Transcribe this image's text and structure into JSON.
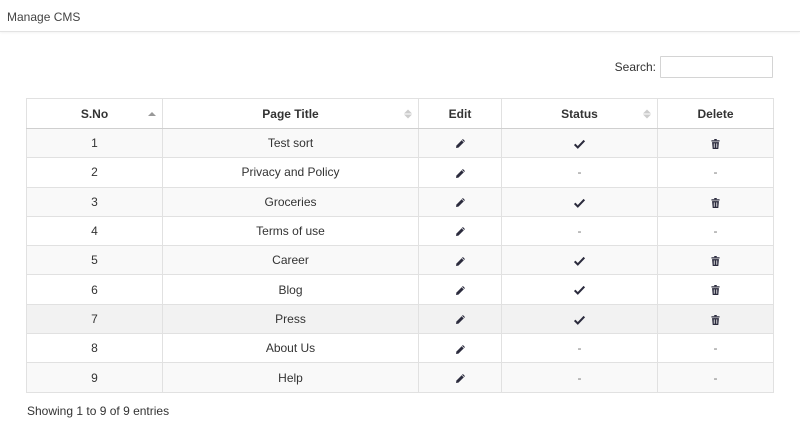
{
  "page": {
    "title": "Manage CMS"
  },
  "search": {
    "label": "Search:",
    "value": "",
    "placeholder": ""
  },
  "table": {
    "columns": [
      "S.No",
      "Page Title",
      "Edit",
      "Status",
      "Delete"
    ],
    "rows": [
      {
        "sno": "1",
        "title": "Test sort",
        "status": "check",
        "delete": "trash"
      },
      {
        "sno": "2",
        "title": "Privacy and Policy",
        "status": "-",
        "delete": "-"
      },
      {
        "sno": "3",
        "title": "Groceries",
        "status": "check",
        "delete": "trash"
      },
      {
        "sno": "4",
        "title": "Terms of use",
        "status": "-",
        "delete": "-"
      },
      {
        "sno": "5",
        "title": "Career",
        "status": "check",
        "delete": "trash"
      },
      {
        "sno": "6",
        "title": "Blog",
        "status": "check",
        "delete": "trash"
      },
      {
        "sno": "7",
        "title": "Press",
        "status": "check",
        "delete": "trash"
      },
      {
        "sno": "8",
        "title": "About Us",
        "status": "-",
        "delete": "-"
      },
      {
        "sno": "9",
        "title": "Help",
        "status": "-",
        "delete": "-"
      }
    ]
  },
  "icons": {
    "edit": "pencil-icon",
    "status": "check-icon",
    "delete": "trash-icon"
  },
  "colors": {
    "icon": "#2b2b3d",
    "border": "#e1e1e1",
    "row_alt": "#f9f9f9"
  },
  "footer": {
    "info": "Showing 1 to 9 of 9 entries"
  }
}
